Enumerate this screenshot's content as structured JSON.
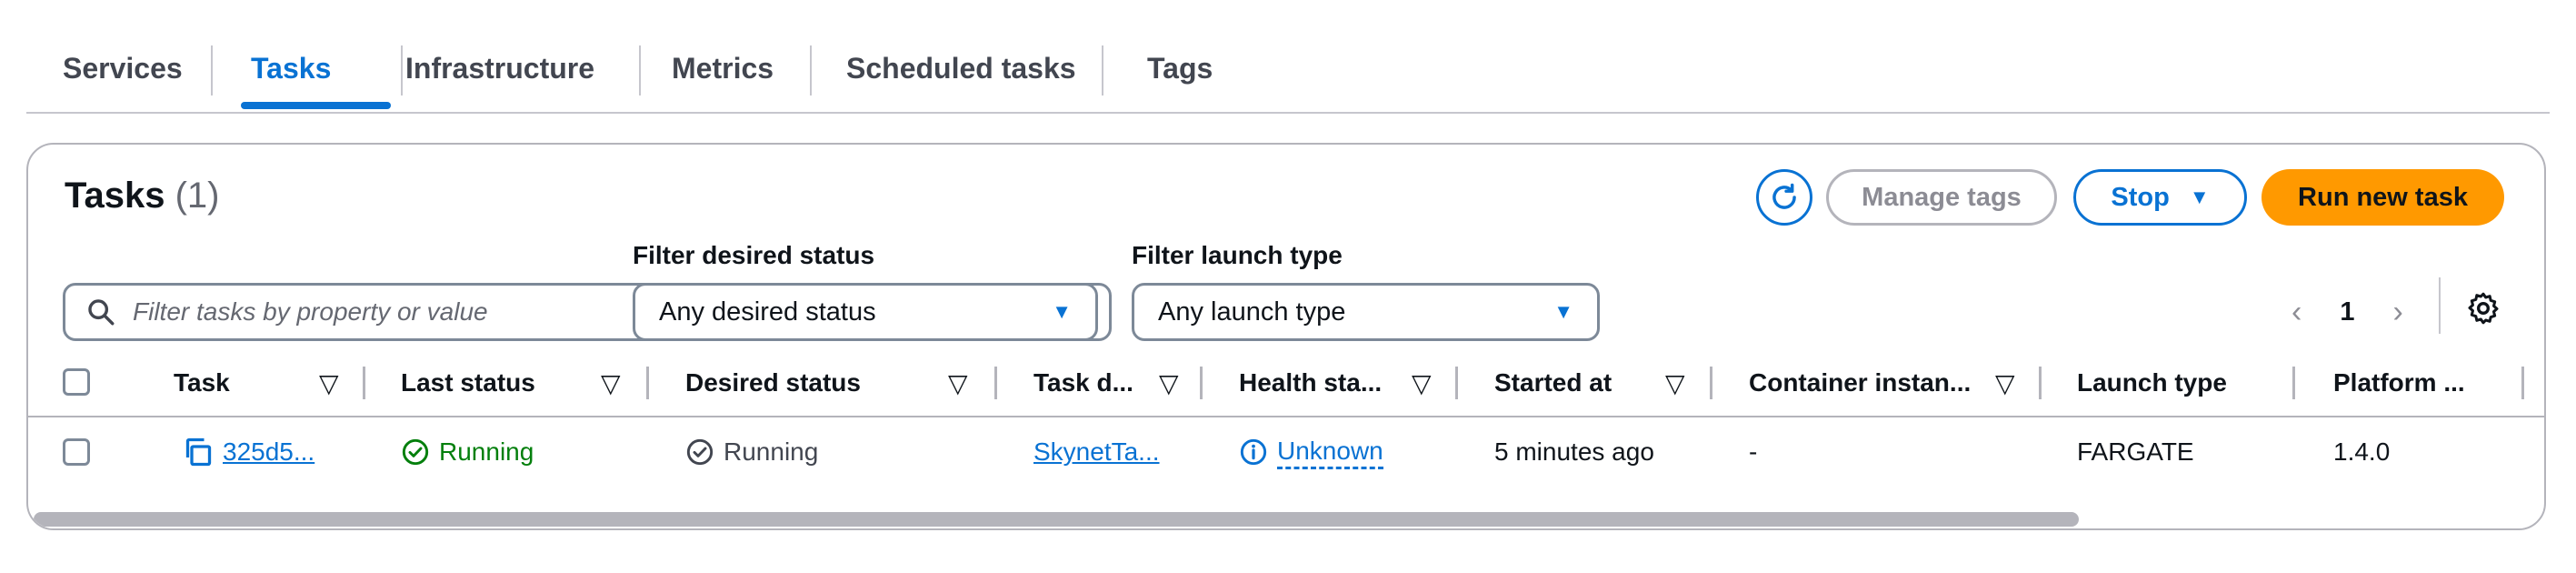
{
  "tabs": [
    {
      "label": "Services",
      "active": false
    },
    {
      "label": "Tasks",
      "active": true
    },
    {
      "label": "Infrastructure",
      "active": false
    },
    {
      "label": "Metrics",
      "active": false
    },
    {
      "label": "Scheduled tasks",
      "active": false
    },
    {
      "label": "Tags",
      "active": false
    }
  ],
  "panel": {
    "title": "Tasks",
    "count": "(1)",
    "buttons": {
      "refresh_icon": "refresh-icon",
      "manage_tags": "Manage tags",
      "stop": "Stop",
      "run_new_task": "Run new task"
    }
  },
  "filters": {
    "search_placeholder": "Filter tasks by property or value",
    "desired_status_label": "Filter desired status",
    "desired_status_value": "Any desired status",
    "launch_type_label": "Filter launch type",
    "launch_type_value": "Any launch type"
  },
  "pagination": {
    "page": "1"
  },
  "table": {
    "headers": [
      "Task",
      "Last status",
      "Desired status",
      "Task d...",
      "Health sta...",
      "Started at",
      "Container instan...",
      "Launch type",
      "Platform ..."
    ],
    "rows": [
      {
        "task": "325d5...",
        "last_status": "Running",
        "desired_status": "Running",
        "task_definition": "SkynetTa...",
        "health_status": "Unknown",
        "started_at": "5 minutes ago",
        "container_instance": "-",
        "launch_type": "FARGATE",
        "platform": "1.4.0"
      }
    ]
  },
  "colors": {
    "accent": "#0972d3",
    "primary_button": "#ff9900",
    "success": "#037f0c"
  }
}
